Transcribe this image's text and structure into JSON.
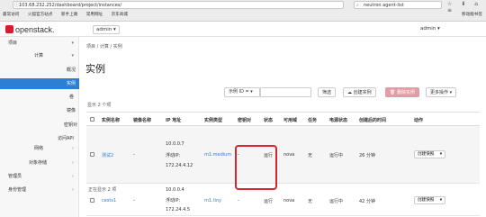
{
  "browser": {
    "url": "103.68.232.252/dashboard/project/instances/",
    "search": "neutron agent-list",
    "bookmarks": [
      "最常访问",
      "火狐官方站点",
      "新手上路",
      "常用网址",
      "京东商城"
    ],
    "bookmark_right": "移动版书签"
  },
  "header": {
    "brand": "openstack.",
    "project": "admin ▾",
    "user": "admin ▾"
  },
  "sidebar": {
    "items": [
      {
        "label": "项目",
        "chev": "▾"
      },
      {
        "label": "计算",
        "chev": "▾"
      },
      {
        "label": "概况",
        "chev": ""
      },
      {
        "label": "实例",
        "chev": ""
      },
      {
        "label": "卷",
        "chev": ""
      },
      {
        "label": "镜像",
        "chev": ""
      },
      {
        "label": "密钥对",
        "chev": ""
      },
      {
        "label": "访问API",
        "chev": ""
      },
      {
        "label": "网络",
        "chev": "›"
      },
      {
        "label": "对象存储",
        "chev": "›"
      },
      {
        "label": "管理员",
        "chev": "›"
      },
      {
        "label": "身份管理",
        "chev": "›"
      }
    ]
  },
  "main": {
    "breadcrumb": "项目 / 计算 / 实例",
    "title": "实例",
    "filter_label": "示例 ID = ▾",
    "buttons": {
      "filter": "筛选",
      "create": "创建实例",
      "delete": "删除实例",
      "more": "更多操作 ▾"
    },
    "count_top": "显示 2 个项",
    "count_bottom": "正在显示 2 项",
    "columns": [
      "实例名称",
      "镜像名称",
      "IP 地址",
      "实例类型",
      "密钥对",
      "状态",
      "可用域",
      "任务",
      "电源状态",
      "创建后的时间",
      "动作"
    ],
    "rows": [
      {
        "name": "测试2",
        "image": "-",
        "ip_lines": [
          "10.0.0.7",
          "浮动IP:",
          "172.24.4.12"
        ],
        "flavor": "m1.medium",
        "keypair": "-",
        "status": "运行",
        "zone": "nova",
        "task": "无",
        "power": "运行中",
        "age": "26 分钟",
        "action": "创建快照"
      },
      {
        "name": "cests1",
        "image": "-",
        "ip_lines": [
          "10.0.0.4",
          "浮动IP:",
          "172.24.4.5"
        ],
        "flavor": "m1.tiny",
        "keypair": "-",
        "status": "运行",
        "zone": "nova",
        "task": "无",
        "power": "运行中",
        "age": "42 分钟",
        "action": "创建快照"
      }
    ]
  },
  "colors": {
    "accent": "#2c7fd2",
    "highlight": "#d9262d",
    "brand": "#da1a32"
  }
}
